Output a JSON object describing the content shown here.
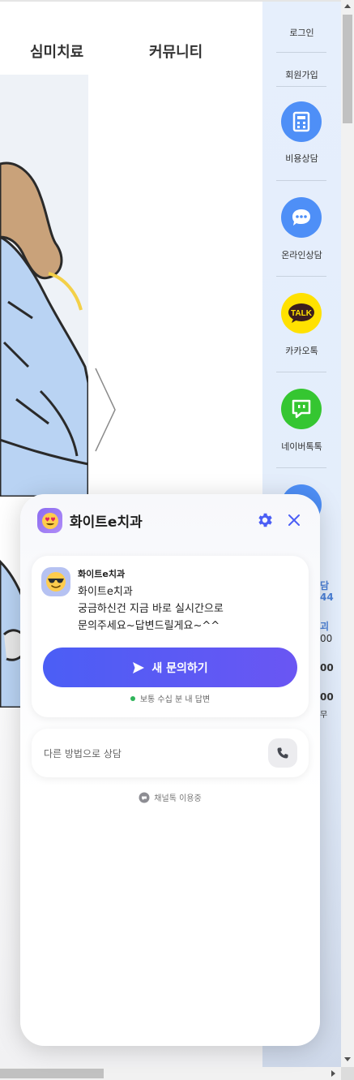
{
  "nav": {
    "items": [
      "심미치료",
      "커뮤니티"
    ]
  },
  "quick_menu": {
    "login": "로그인",
    "signup": "회원가입",
    "items": [
      {
        "label": "비용상담",
        "icon": "calculator-icon",
        "color": "#4e8ff7"
      },
      {
        "label": "온라인상담",
        "icon": "chat-bubble-icon",
        "color": "#4e8ff7"
      },
      {
        "label": "카카오톡",
        "icon": "kakaotalk-icon",
        "icon_text": "TALK",
        "color": "#ffe100"
      },
      {
        "label": "네이버톡톡",
        "icon": "naver-talktalk-icon",
        "color": "#35c631"
      }
    ],
    "partial_texts": [
      "담",
      "44",
      "괴",
      "00",
      "00",
      "00",
      "무"
    ]
  },
  "chat": {
    "title": "화이트e치과",
    "logo_icon": "smiling-face-with-heart-eyes-icon",
    "settings_icon": "gear-icon",
    "close_icon": "close-icon",
    "accent": "#4b5ef5",
    "message": {
      "sender": "화이트e치과",
      "avatar_icon": "sunglasses-face-icon",
      "lines": [
        "화이트e치과",
        "궁금하신건 지금 바로 실시간으로",
        "문의주세요~답변드릴게요~^^"
      ]
    },
    "new_inquiry_button": "새 문의하기",
    "reply_time": "보통 수십 분 내 답변",
    "reply_status_color": "#2fb45a",
    "other_method": "다른 방법으로 상담",
    "phone_icon": "phone-icon",
    "powered_by": "채널톡 이용중"
  }
}
